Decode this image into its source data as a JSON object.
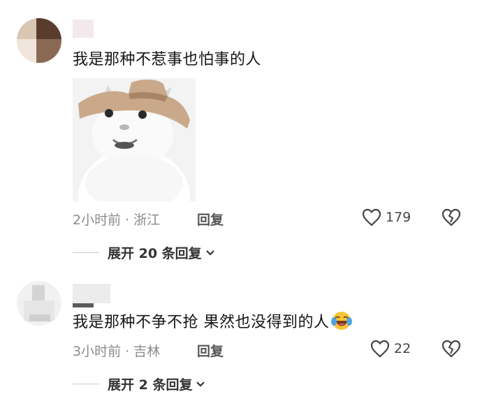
{
  "comments": [
    {
      "text": "我是那种不惹事也怕事的人",
      "time": "2小时前",
      "separator": "·",
      "location": "浙江",
      "reply_label": "回复",
      "likes": "179",
      "expand_label": "展开 20 条回复"
    },
    {
      "text": "我是那种不争不抢 果然也没得到的人",
      "emoji": "laughing-crying-emoji",
      "time": "3小时前",
      "separator": "·",
      "location": "吉林",
      "reply_label": "回复",
      "likes": "22",
      "expand_label": "展开 2 条回复"
    }
  ],
  "colors": {
    "meta": "#8a8a8a",
    "text": "#161616",
    "icon": "#444444"
  },
  "icons": [
    "heart-outline-icon",
    "broken-heart-icon",
    "chevron-down-icon"
  ]
}
